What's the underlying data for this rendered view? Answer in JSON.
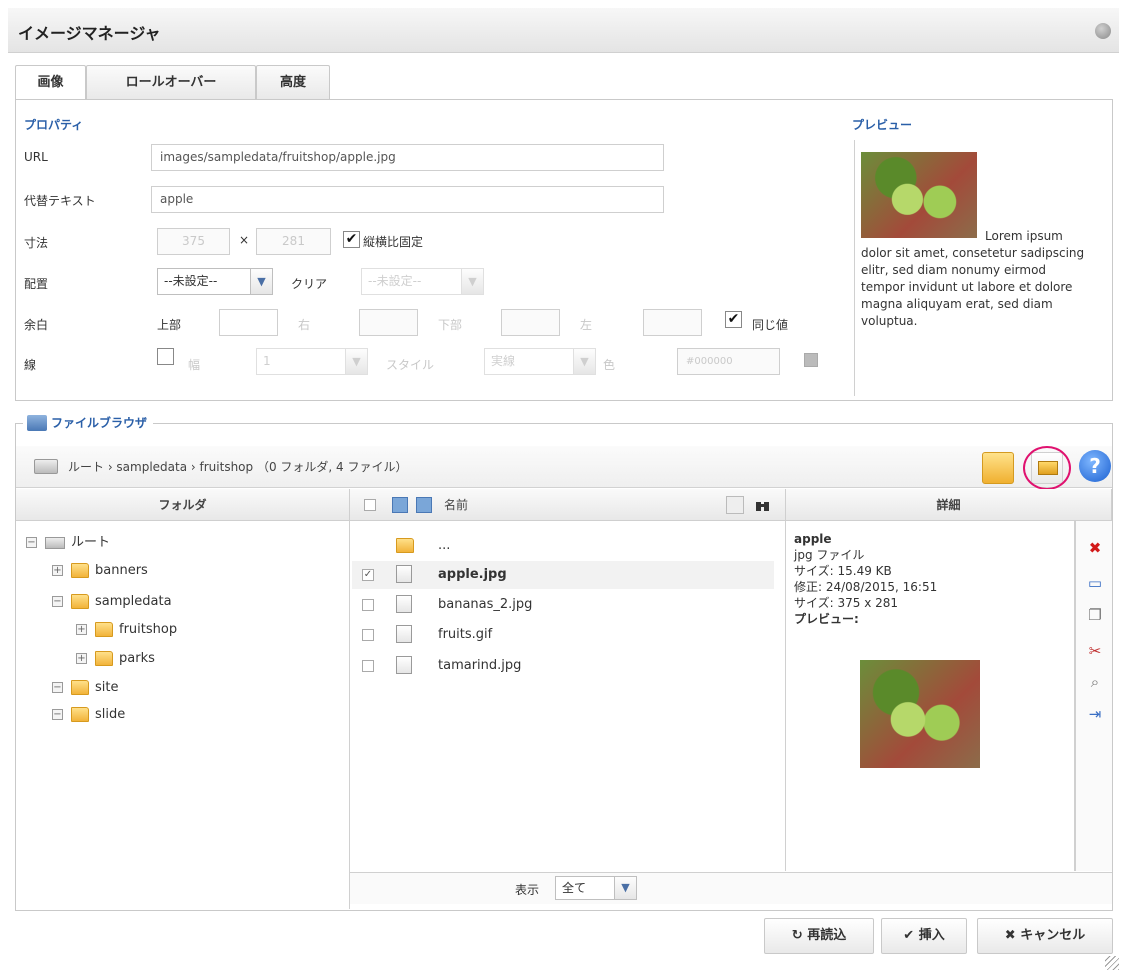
{
  "window": {
    "title": "イメージマネージャ"
  },
  "tabs": [
    {
      "label": "画像"
    },
    {
      "label": "ロールオーバー"
    },
    {
      "label": "高度"
    }
  ],
  "properties": {
    "section_label": "プロパティ",
    "url_label": "URL",
    "url_value": "images/sampledata/fruitshop/apple.jpg",
    "alt_label": "代替テキスト",
    "alt_value": "apple",
    "size_label": "寸法",
    "width": "375",
    "times": "×",
    "height": "281",
    "keep_ratio_label": "縦横比固定",
    "keep_ratio_checked": true,
    "align_label": "配置",
    "align_value": "--未設定--",
    "clear_label": "クリア",
    "clear_value": "--未設定--",
    "margin_label": "余白",
    "margin_top_label": "上部",
    "margin_right_label": "右",
    "margin_bottom_label": "下部",
    "margin_left_label": "左",
    "same_label": "同じ値",
    "same_checked": true,
    "border_label": "線",
    "border_width_label": "幅",
    "border_width_value": "1",
    "border_style_label": "スタイル",
    "border_style_value": "実線",
    "border_color_label": "色",
    "border_color_value": "#000000"
  },
  "preview": {
    "section_label": "プレビュー",
    "text_line1": "Lorem ipsum",
    "text_rest": "dolor sit amet, consetetur sadipscing elitr, sed diam nonumy eirmod tempor invidunt ut labore et dolore magna aliquyam erat, sed diam voluptua."
  },
  "file_browser": {
    "legend": "ファイルブラウザ",
    "path": "ルート › sampledata › fruitshop （0 フォルダ, 4 ファイル）",
    "col_folder": "フォルダ",
    "col_name": "名前",
    "col_details": "詳細",
    "tree": [
      {
        "label": "ルート",
        "expander": "−",
        "type": "drive"
      },
      {
        "label": "banners",
        "expander": "+",
        "type": "folder"
      },
      {
        "label": "sampledata",
        "expander": "−",
        "type": "folder"
      },
      {
        "label": "fruitshop",
        "expander": "+",
        "type": "folder"
      },
      {
        "label": "parks",
        "expander": "+",
        "type": "folder"
      },
      {
        "label": "site",
        "expander": "−",
        "type": "folder"
      },
      {
        "label": "slide",
        "expander": "−",
        "type": "folder"
      }
    ],
    "files": [
      {
        "name": "...",
        "checked": false,
        "selected": false
      },
      {
        "name": "apple.jpg",
        "checked": true,
        "selected": true
      },
      {
        "name": "bananas_2.jpg",
        "checked": false,
        "selected": false
      },
      {
        "name": "fruits.gif",
        "checked": false,
        "selected": false
      },
      {
        "name": "tamarind.jpg",
        "checked": false,
        "selected": false
      }
    ],
    "details": {
      "name": "apple",
      "type": "jpg ファイル",
      "size": "サイズ: 15.49 KB",
      "modified": "修正: 24/08/2015, 16:51",
      "dimensions": "サイズ: 375 x 281",
      "preview_label": "プレビュー:"
    },
    "show_label": "表示",
    "show_value": "全て"
  },
  "buttons": {
    "reload": "↻ 再読込",
    "insert": "✔ 挿入",
    "cancel": "✖ キャンセル"
  },
  "colors": {
    "accent": "#2a5fa8",
    "highlight": "#e0116f"
  }
}
